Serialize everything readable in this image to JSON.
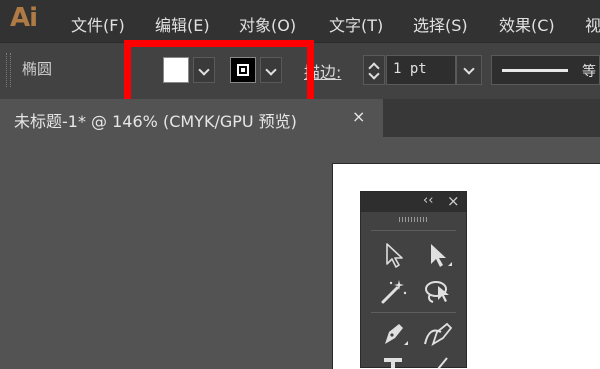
{
  "app": {
    "logo": "Ai"
  },
  "menu": [
    {
      "label": "文件(F)"
    },
    {
      "label": "编辑(E)"
    },
    {
      "label": "对象(O)"
    },
    {
      "label": "文字(T)"
    },
    {
      "label": "选择(S)"
    },
    {
      "label": "效果(C)"
    },
    {
      "label": "视"
    }
  ],
  "control_bar": {
    "tool_name": "椭圆",
    "fill_color": "#ffffff",
    "stroke_color": "#000000",
    "stroke_label": "描边:",
    "stroke_weight": "1 pt",
    "line_style_label": "等"
  },
  "highlight_color": "#ff0000",
  "document_tab": {
    "title": "未标题-1* @ 146% (CMYK/GPU 预览)",
    "close": "×"
  },
  "tools_panel": {
    "collapse": "‹‹",
    "close": "×",
    "tools": [
      {
        "icon": "direct-selection-icon"
      },
      {
        "icon": "selection-icon"
      },
      {
        "icon": "magic-wand-icon"
      },
      {
        "icon": "lasso-icon"
      },
      {
        "icon": "pen-icon"
      },
      {
        "icon": "curvature-icon"
      },
      {
        "icon": "type-icon",
        "label": "T"
      },
      {
        "icon": "line-segment-icon"
      }
    ]
  }
}
